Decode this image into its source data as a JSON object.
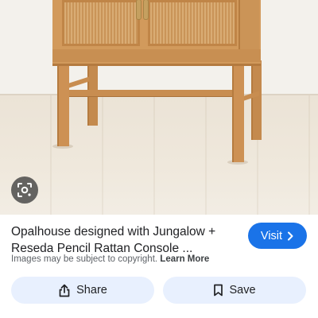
{
  "product": {
    "title_line1": "Opalhouse designed with Jungalow +",
    "title_line2": "Reseda Pencil Rattan Console ...",
    "copyright_text": "Images may be subject to copyright.",
    "learn_more": "Learn More"
  },
  "actions": {
    "visit_label": "Visit",
    "share_label": "Share",
    "save_label": "Save"
  },
  "icons": {
    "lens": "lens-icon",
    "chevron": "chevron-right-icon",
    "share": "share-icon",
    "bookmark": "bookmark-icon"
  },
  "colors": {
    "accent": "#1a73e8",
    "button_bg": "#e8f0fe",
    "wood": "#d29a5c"
  }
}
